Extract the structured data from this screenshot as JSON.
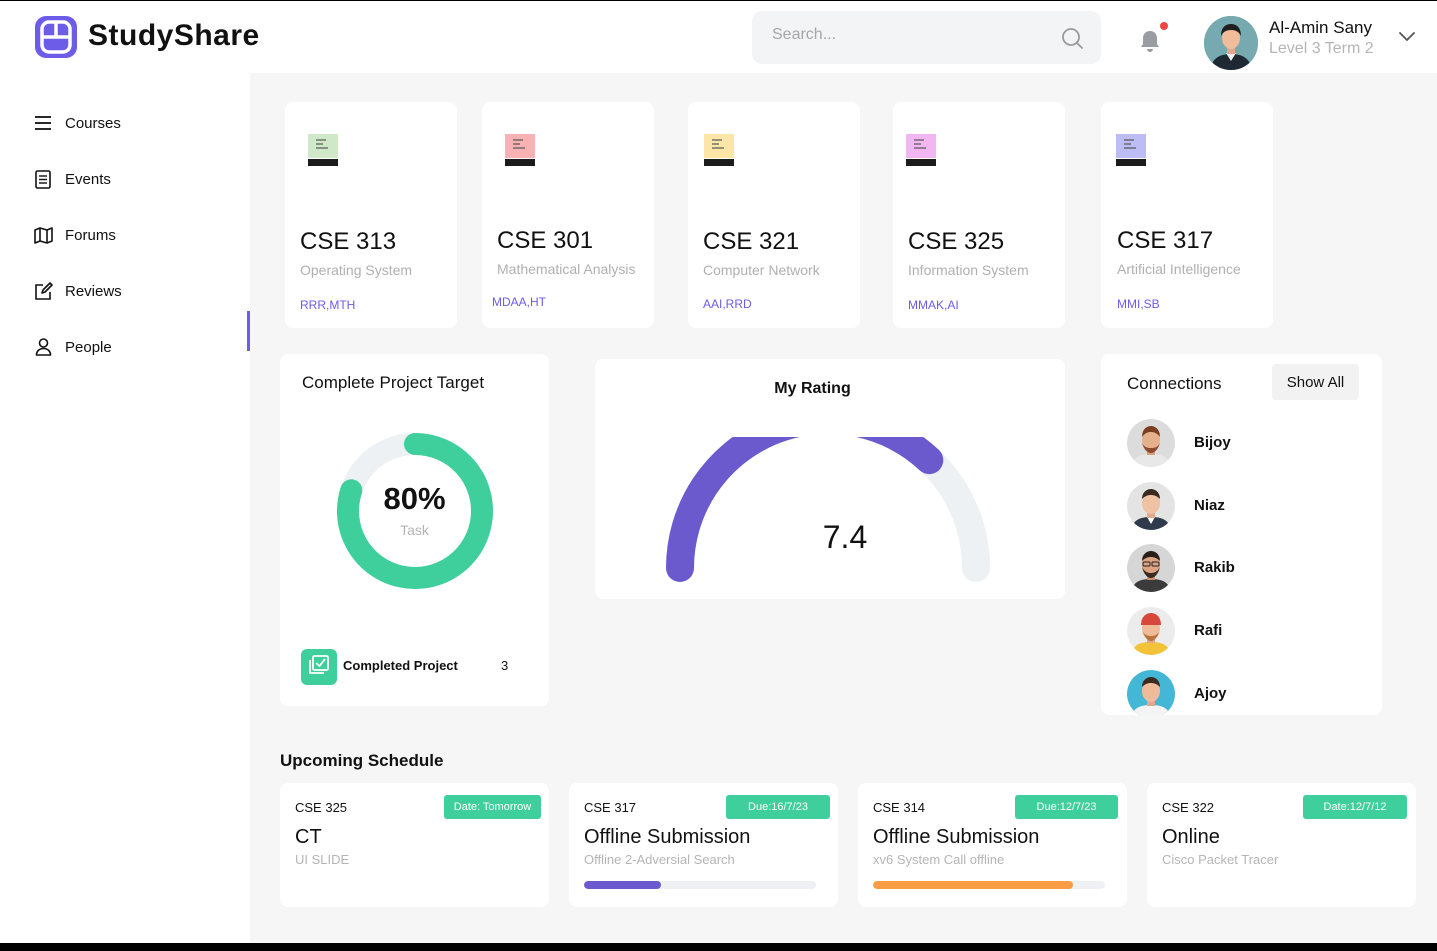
{
  "app": {
    "brand": "StudyShare"
  },
  "search": {
    "placeholder": "Search..."
  },
  "user": {
    "name": "Al-Amin Sany",
    "level": "Level 3 Term 2"
  },
  "sidebar": {
    "items": [
      {
        "label": "Courses",
        "icon": "menu-icon"
      },
      {
        "label": "Events",
        "icon": "document-icon"
      },
      {
        "label": "Forums",
        "icon": "map-icon"
      },
      {
        "label": "Reviews",
        "icon": "edit-icon"
      },
      {
        "label": "People",
        "icon": "user-icon"
      }
    ]
  },
  "courses": [
    {
      "code": "CSE 313",
      "name": "Operating System",
      "instructors": "RRR,MTH",
      "color": "#cfe8c8"
    },
    {
      "code": "CSE 301",
      "name": "Mathematical Analysis",
      "instructors": "MDAA,HT",
      "color": "#f7b3b3"
    },
    {
      "code": "CSE 321",
      "name": "Computer Network",
      "instructors": "AAI,RRD",
      "color": "#fbe6a8"
    },
    {
      "code": "CSE 325",
      "name": "Information System",
      "instructors": "MMAK,AI",
      "color": "#f2b6f2"
    },
    {
      "code": "CSE 317",
      "name": "Artificial Intelligence",
      "instructors": "MMI,SB",
      "color": "#bdbdf5"
    }
  ],
  "project_target": {
    "title": "Complete Project Target",
    "percent_label": "80%",
    "percent_value": 80,
    "sub_label": "Task",
    "completed_label": "Completed Project",
    "completed_count": "3",
    "color": "#3ecf9c"
  },
  "rating": {
    "title": "My Rating",
    "value": "7.4",
    "max": 10,
    "color": "#6a5acd"
  },
  "connections": {
    "title": "Connections",
    "show_all": "Show All",
    "people": [
      {
        "name": "Bijoy"
      },
      {
        "name": "Niaz"
      },
      {
        "name": "Rakib"
      },
      {
        "name": "Rafi"
      },
      {
        "name": "Ajoy"
      }
    ]
  },
  "schedule": {
    "title": "Upcoming Schedule",
    "items": [
      {
        "code": "CSE 325",
        "badge": "Date: Tomorrow",
        "title": "CT",
        "subtitle": "UI SLIDE"
      },
      {
        "code": "CSE 317",
        "badge": "Due:16/7/23",
        "title": "Offline Submission",
        "subtitle": "Offline 2-Adversial Search",
        "progress": 0.33,
        "progress_color": "#6a5acd"
      },
      {
        "code": "CSE 314",
        "badge": "Due:12/7/23",
        "title": "Offline Submission",
        "subtitle": "xv6 System Call offline",
        "progress": 0.86,
        "progress_color": "#fb9d45"
      },
      {
        "code": "CSE 322",
        "badge": "Date:12/7/12",
        "title": "Online",
        "subtitle": "Cisco Packet Tracer"
      }
    ]
  }
}
